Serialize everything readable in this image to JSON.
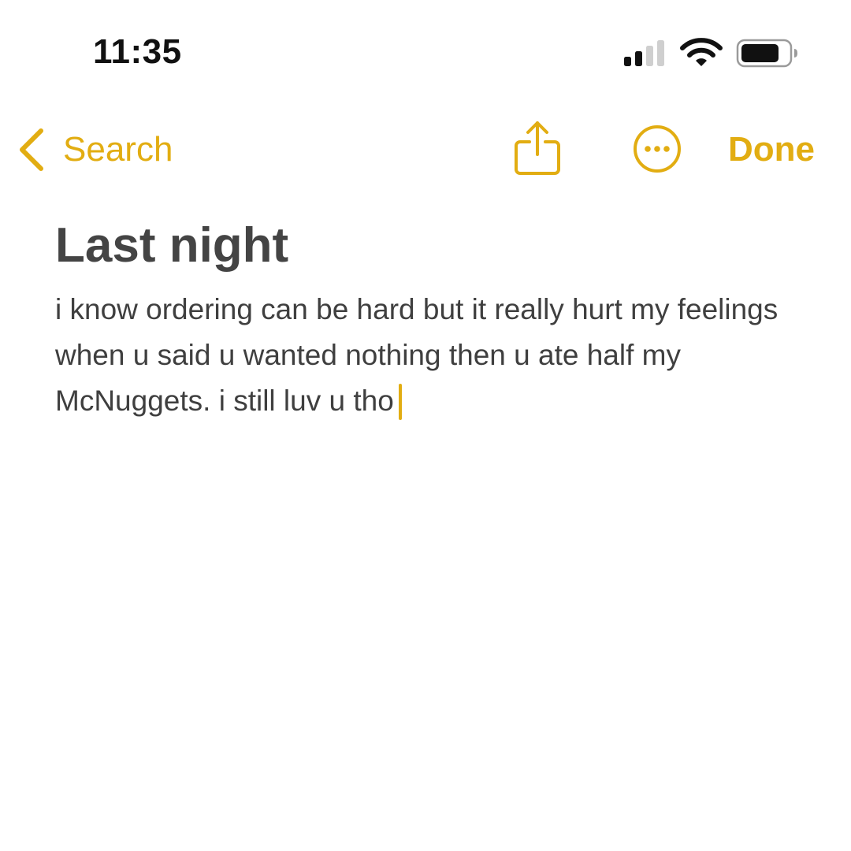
{
  "status_bar": {
    "time": "11:35",
    "icons": [
      "cellular-signal-icon",
      "wifi-icon",
      "battery-icon"
    ]
  },
  "nav": {
    "back_label": "Search",
    "done_label": "Done",
    "icons": [
      "chevron-left-icon",
      "share-icon",
      "more-icon"
    ]
  },
  "note": {
    "title": "Last night",
    "body": "i know ordering can be hard but it really hurt my feelings when u said u wanted nothing then u ate half my McNuggets. i still luv u tho"
  },
  "colors": {
    "accent": "#E2AD12",
    "title_text": "#444444",
    "body_text": "#3f3f3f",
    "background": "#ffffff"
  }
}
